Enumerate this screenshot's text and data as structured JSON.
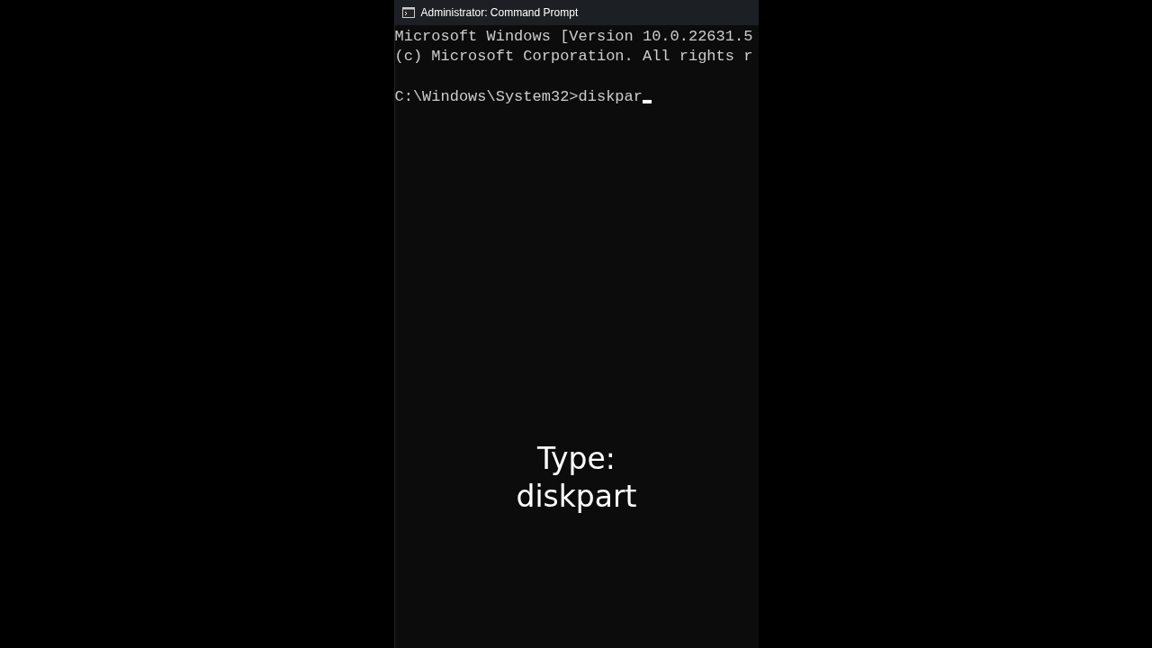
{
  "window": {
    "title": "Administrator: Command Prompt"
  },
  "console": {
    "output_lines": [
      "Microsoft Windows [Version 10.0.22631.5",
      "(c) Microsoft Corporation. All rights r"
    ],
    "command_line": "C:\\Windows\\System32>diskpar",
    "cursor": true
  },
  "caption": [
    "Type:",
    "diskpart"
  ]
}
